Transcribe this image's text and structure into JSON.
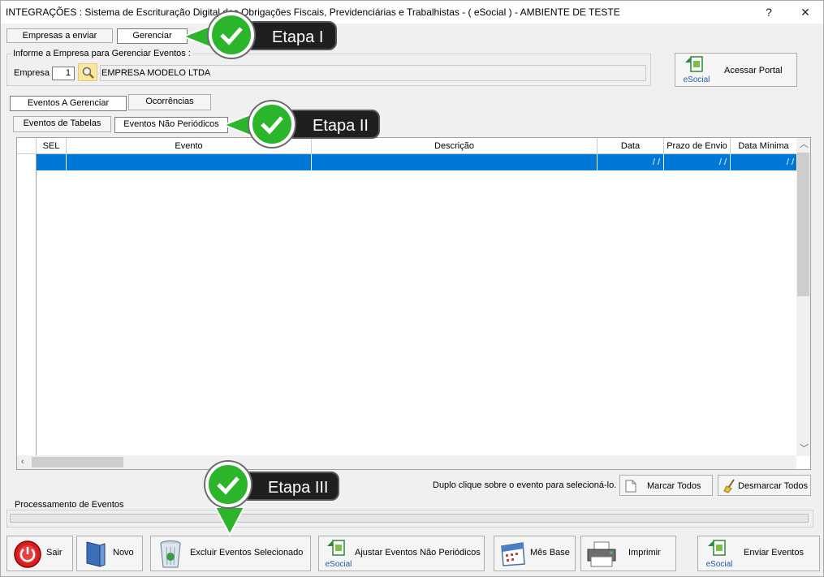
{
  "window": {
    "title": "INTEGRAÇÕES : Sistema de Escrituração Digital das Obrigações Fiscais, Previdenciárias e Trabalhistas - ( eSocial ) - AMBIENTE DE TESTE",
    "help": "?",
    "close": "✕"
  },
  "top_tabs": [
    {
      "label": "Empresas a enviar"
    },
    {
      "label": "Gerenciar"
    }
  ],
  "company_group": {
    "label": "Informe a Empresa para Gerenciar Eventos :",
    "empresa_label": "Empresa",
    "empresa_code": "1",
    "empresa_name": "EMPRESA MODELO LTDA"
  },
  "portal_button": {
    "label": "Acessar Portal",
    "logo": "eSocial"
  },
  "sub_tabs": [
    {
      "label": "Eventos A Gerenciar"
    },
    {
      "label": "Ocorrências"
    }
  ],
  "event_tabs": [
    {
      "label": "Eventos de Tabelas"
    },
    {
      "label": "Eventos Não Periódicos"
    }
  ],
  "grid": {
    "columns": [
      "SEL",
      "Evento",
      "Descrição",
      "Data",
      "Prazo de Envio",
      "Data Mínima"
    ],
    "rows": [
      {
        "sel": "",
        "evento": "",
        "descricao": "",
        "data": "/  /",
        "prazo": "/  /",
        "data_minima": "/  /"
      }
    ]
  },
  "hint": "Duplo clique sobre o evento para selecioná-lo.",
  "mark_all": "Marcar Todos",
  "unmark_all": "Desmarcar Todos",
  "processing_label": "Processamento de Eventos",
  "processing_progress": 0,
  "actions": [
    {
      "label": "Sair",
      "icon": "power-icon"
    },
    {
      "label": "Novo",
      "icon": "book-icon"
    },
    {
      "label": "Excluir Eventos Selecionado",
      "icon": "trash-icon"
    },
    {
      "label": "Ajustar Eventos Não Periódicos",
      "icon": "esocial-logo"
    },
    {
      "label": "Mês Base",
      "icon": "calendar-icon"
    },
    {
      "label": "Imprimir",
      "icon": "printer-icon"
    },
    {
      "label": "Enviar Eventos",
      "icon": "esocial-logo"
    }
  ],
  "callouts": [
    {
      "label": "Etapa I"
    },
    {
      "label": "Etapa II"
    },
    {
      "label": "Etapa III"
    }
  ],
  "colors": {
    "selection": "#0078d7",
    "callout_green": "#2bb52b",
    "callout_dark": "#1f1f1f"
  }
}
